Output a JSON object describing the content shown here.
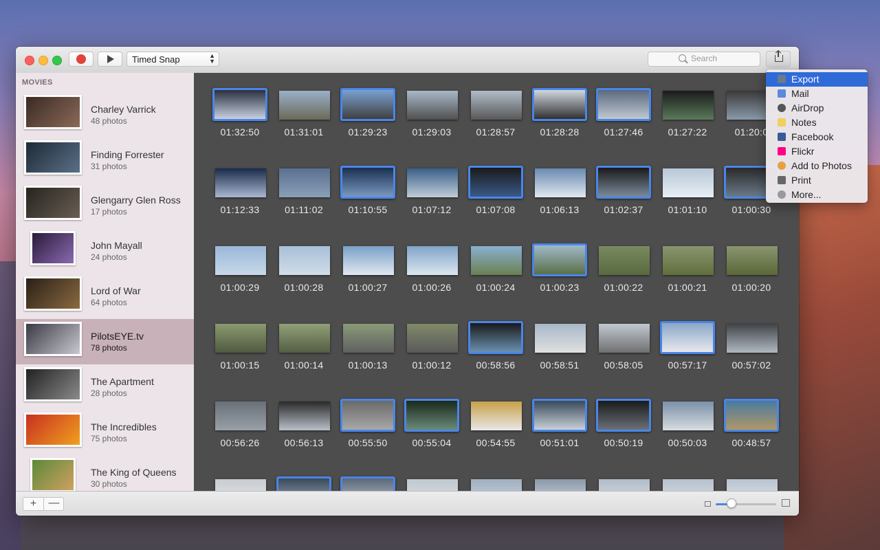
{
  "toolbar": {
    "mode_selected": "Timed Snap",
    "search_placeholder": "Search"
  },
  "sidebar": {
    "heading": "MOVIES",
    "movies": [
      {
        "title": "Charley Varrick",
        "count": "48 photos",
        "colors": [
          "#3a2a24",
          "#8a6a58"
        ]
      },
      {
        "title": "Finding Forrester",
        "count": "31 photos",
        "colors": [
          "#1e2a36",
          "#5a7088"
        ]
      },
      {
        "title": "Glengarry Glen Ross",
        "count": "17 photos",
        "colors": [
          "#26241f",
          "#6a5e52"
        ]
      },
      {
        "title": "John Mayall",
        "count": "24 photos",
        "colors": [
          "#2a1a3a",
          "#8a6ab0"
        ]
      },
      {
        "title": "Lord of War",
        "count": "64 photos",
        "colors": [
          "#2a2018",
          "#8a6a40"
        ]
      },
      {
        "title": "PilotsEYE.tv",
        "count": "78 photos",
        "colors": [
          "#3a3a44",
          "#c8c8d0"
        ]
      },
      {
        "title": "The Apartment",
        "count": "28 photos",
        "colors": [
          "#222222",
          "#8a8a8a"
        ]
      },
      {
        "title": "The Incredibles",
        "count": "75 photos",
        "colors": [
          "#c83020",
          "#f0a020"
        ]
      },
      {
        "title": "The King of Queens",
        "count": "30 photos",
        "colors": [
          "#5a8a3a",
          "#d0a060"
        ]
      }
    ]
  },
  "grid": {
    "rows": [
      [
        {
          "time": "01:32:50",
          "sel": true,
          "colors": [
            "#2a3040",
            "#c8d0e0"
          ]
        },
        {
          "time": "01:31:01",
          "sel": false,
          "colors": [
            "#9ab0c8",
            "#6a6a58"
          ]
        },
        {
          "time": "01:29:23",
          "sel": true,
          "colors": [
            "#7aa0d0",
            "#404040"
          ]
        },
        {
          "time": "01:29:03",
          "sel": false,
          "colors": [
            "#a8b8c8",
            "#505050"
          ]
        },
        {
          "time": "01:28:57",
          "sel": false,
          "colors": [
            "#b0bcc8",
            "#585858"
          ]
        },
        {
          "time": "01:28:28",
          "sel": true,
          "colors": [
            "#d0d8e0",
            "#303030"
          ]
        },
        {
          "time": "01:27:46",
          "sel": true,
          "colors": [
            "#5a6a80",
            "#c0c8d0"
          ]
        },
        {
          "time": "01:27:22",
          "sel": false,
          "colors": [
            "#1a1a1a",
            "#5a7a5a"
          ]
        },
        {
          "time": "01:20:0",
          "sel": false,
          "colors": [
            "#3a3a3a",
            "#8a9aaa"
          ]
        }
      ],
      [
        {
          "time": "01:12:33",
          "sel": false,
          "colors": [
            "#1a2a4a",
            "#a8b8d0"
          ]
        },
        {
          "time": "01:11:02",
          "sel": false,
          "colors": [
            "#5a7090",
            "#8aa0b8"
          ]
        },
        {
          "time": "01:10:55",
          "sel": true,
          "colors": [
            "#1a3050",
            "#7a98c0"
          ]
        },
        {
          "time": "01:07:12",
          "sel": false,
          "colors": [
            "#3a6088",
            "#c0ccd8"
          ]
        },
        {
          "time": "01:07:08",
          "sel": true,
          "colors": [
            "#1a1a1a",
            "#3a5a88"
          ]
        },
        {
          "time": "01:06:13",
          "sel": false,
          "colors": [
            "#6a8ab0",
            "#e0e8f0"
          ]
        },
        {
          "time": "01:02:37",
          "sel": true,
          "colors": [
            "#1a1a1a",
            "#7a8a9a"
          ]
        },
        {
          "time": "01:01:10",
          "sel": false,
          "colors": [
            "#b8c8d8",
            "#e8eef4"
          ]
        },
        {
          "time": "01:00:30",
          "sel": true,
          "colors": [
            "#2a2a2a",
            "#6a7a8a"
          ]
        }
      ],
      [
        {
          "time": "01:00:29",
          "sel": false,
          "colors": [
            "#9ab8d8",
            "#c8d8e8"
          ]
        },
        {
          "time": "01:00:28",
          "sel": false,
          "colors": [
            "#a8c0d8",
            "#d0dce8"
          ]
        },
        {
          "time": "01:00:27",
          "sel": false,
          "colors": [
            "#7aa0c8",
            "#e0e8f0"
          ]
        },
        {
          "time": "01:00:26",
          "sel": false,
          "colors": [
            "#80a4c8",
            "#dce6f0"
          ]
        },
        {
          "time": "01:00:24",
          "sel": false,
          "colors": [
            "#8ab0d0",
            "#6a8050"
          ]
        },
        {
          "time": "01:00:23",
          "sel": true,
          "colors": [
            "#a0b8c8",
            "#5a7048"
          ]
        },
        {
          "time": "01:00:22",
          "sel": false,
          "colors": [
            "#7a8a60",
            "#5a6a40"
          ]
        },
        {
          "time": "01:00:21",
          "sel": false,
          "colors": [
            "#8a9470",
            "#60703c"
          ]
        },
        {
          "time": "01:00:20",
          "sel": false,
          "colors": [
            "#8a9470",
            "#5a6838"
          ]
        }
      ],
      [
        {
          "time": "01:00:15",
          "sel": false,
          "colors": [
            "#8a9a70",
            "#505a40"
          ]
        },
        {
          "time": "01:00:14",
          "sel": false,
          "colors": [
            "#90a078",
            "#545e44"
          ]
        },
        {
          "time": "01:00:13",
          "sel": false,
          "colors": [
            "#8a9a78",
            "#606060"
          ]
        },
        {
          "time": "01:00:12",
          "sel": false,
          "colors": [
            "#808a6a",
            "#5a5a5a"
          ]
        },
        {
          "time": "00:58:56",
          "sel": true,
          "colors": [
            "#1a1a1a",
            "#6a90b0"
          ]
        },
        {
          "time": "00:58:51",
          "sel": false,
          "colors": [
            "#a8b8c8",
            "#e0e0e0"
          ]
        },
        {
          "time": "00:58:05",
          "sel": false,
          "colors": [
            "#c0c8d0",
            "#707070"
          ]
        },
        {
          "time": "00:57:17",
          "sel": true,
          "colors": [
            "#8aa8c8",
            "#e8e8ec"
          ]
        },
        {
          "time": "00:57:02",
          "sel": false,
          "colors": [
            "#404448",
            "#b0b8c0"
          ]
        }
      ],
      [
        {
          "time": "00:56:26",
          "sel": false,
          "colors": [
            "#6a7078",
            "#9aa0a8"
          ]
        },
        {
          "time": "00:56:13",
          "sel": false,
          "colors": [
            "#2a2a2a",
            "#b8c0c8"
          ]
        },
        {
          "time": "00:55:50",
          "sel": true,
          "colors": [
            "#6a6a6a",
            "#a8a8a8"
          ]
        },
        {
          "time": "00:55:04",
          "sel": true,
          "colors": [
            "#1a2a1a",
            "#6a8a7a"
          ]
        },
        {
          "time": "00:54:55",
          "sel": false,
          "colors": [
            "#c8a048",
            "#e8e8e8"
          ]
        },
        {
          "time": "00:51:01",
          "sel": true,
          "colors": [
            "#3a4a5a",
            "#c8d0d8"
          ]
        },
        {
          "time": "00:50:19",
          "sel": true,
          "colors": [
            "#1a1a1a",
            "#6a7078"
          ]
        },
        {
          "time": "00:50:03",
          "sel": false,
          "colors": [
            "#7a90a8",
            "#d8dce0"
          ]
        },
        {
          "time": "00:48:57",
          "sel": true,
          "colors": [
            "#4a7aa0",
            "#b09868"
          ]
        }
      ],
      [
        {
          "time": "",
          "sel": false,
          "colors": [
            "#c8ccd0",
            "#e8eaec"
          ]
        },
        {
          "time": "",
          "sel": true,
          "colors": [
            "#3a4a5a",
            "#a0b0c0"
          ]
        },
        {
          "time": "",
          "sel": true,
          "colors": [
            "#5a6878",
            "#c0c8d0"
          ]
        },
        {
          "time": "",
          "sel": false,
          "colors": [
            "#c0c8d0",
            "#dde2e6"
          ]
        },
        {
          "time": "",
          "sel": false,
          "colors": [
            "#a0b0c0",
            "#d0d8e0"
          ]
        },
        {
          "time": "",
          "sel": false,
          "colors": [
            "#8a98a8",
            "#d8dee4"
          ]
        },
        {
          "time": "",
          "sel": false,
          "colors": [
            "#b0bcc8",
            "#e0e4e8"
          ]
        },
        {
          "time": "",
          "sel": false,
          "colors": [
            "#b4c0cc",
            "#e2e6ea"
          ]
        },
        {
          "time": "",
          "sel": false,
          "colors": [
            "#b8c4d0",
            "#e4e8ec"
          ]
        }
      ]
    ]
  },
  "zoom": {
    "level": 0.25
  },
  "share_menu": {
    "items": [
      {
        "label": "Export",
        "icon": "export-icon",
        "color": "#6a7a8a",
        "highlighted": true
      },
      {
        "label": "Mail",
        "icon": "mail-icon",
        "color": "#5a8ad8",
        "highlighted": false
      },
      {
        "label": "AirDrop",
        "icon": "airdrop-icon",
        "color": "#555555",
        "highlighted": false
      },
      {
        "label": "Notes",
        "icon": "notes-icon",
        "color": "#f0d060",
        "highlighted": false
      },
      {
        "label": "Facebook",
        "icon": "facebook-icon",
        "color": "#3b5998",
        "highlighted": false
      },
      {
        "label": "Flickr",
        "icon": "flickr-icon",
        "color": "#ff0084",
        "highlighted": false
      },
      {
        "label": "Add to Photos",
        "icon": "photos-icon",
        "color": "#e8a040",
        "highlighted": false
      },
      {
        "label": "Print",
        "icon": "print-icon",
        "color": "#666666",
        "highlighted": false
      },
      {
        "label": "More...",
        "icon": "more-icon",
        "color": "#999999",
        "highlighted": false
      }
    ]
  }
}
